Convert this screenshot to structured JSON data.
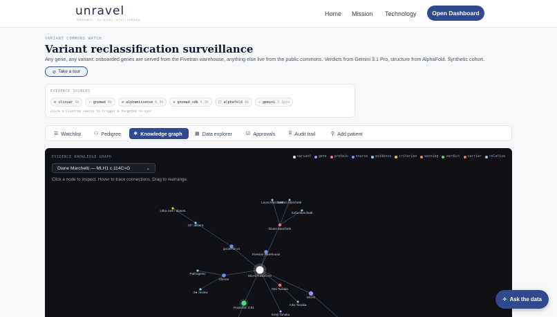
{
  "brand": {
    "name": "unravel",
    "tagline": "GENOMIC · CLINICAL INTELLIGENCE"
  },
  "nav": {
    "home": "Home",
    "mission": "Mission",
    "technology": "Technology",
    "cta": "Open Dashboard"
  },
  "header": {
    "eyebrow": "VARIANT COMMONS WATCH",
    "title": "Variant reclassification surveillance",
    "subtitle": "Any gene, any variant: onboarded genes are served from the Fivetran warehouse, anything else live from the public commons. Verdicts from Gemini 3.1 Pro, structure from AlphaFold. Synthetic cohort.",
    "tour": "Take a tour"
  },
  "sources": {
    "label": "EVIDENCE SOURCES",
    "hint": "click a Fivetran source to trigger a targeted re-sync",
    "chips": [
      {
        "icon": "database-icon",
        "glyph": "≡",
        "name": "clinvar",
        "count": "4k"
      },
      {
        "icon": "sparkle-icon",
        "glyph": "✧",
        "name": "gnomad",
        "count": "4k"
      },
      {
        "icon": "database-icon",
        "glyph": "≡",
        "name": "alphamissense",
        "count": "6.3k"
      },
      {
        "icon": "database-icon",
        "glyph": "≡",
        "name": "gnomad_sdk",
        "count": "6.3k"
      },
      {
        "icon": "cube-icon",
        "glyph": "⬡",
        "name": "alphafold",
        "count": "4b"
      },
      {
        "icon": "sparkle-icon",
        "glyph": "✧",
        "name": "gemini",
        "count": "3.1pro"
      }
    ]
  },
  "tabs": [
    {
      "key": "watchlist",
      "icon": "list-icon",
      "glyph": "☰",
      "label": "Watchlist"
    },
    {
      "key": "pedigree",
      "icon": "people-icon",
      "glyph": "⚇",
      "label": "Pedigree"
    },
    {
      "key": "knowledge",
      "icon": "graph-icon",
      "glyph": "⚛",
      "label": "Knowledge graph"
    },
    {
      "key": "explorer",
      "icon": "grid-icon",
      "glyph": "▦",
      "label": "Data explorer"
    },
    {
      "key": "approvals",
      "icon": "clipboard-icon",
      "glyph": "☑",
      "label": "Approvals"
    },
    {
      "key": "audit",
      "icon": "audit-icon",
      "glyph": "⌸",
      "label": "Audit trail"
    },
    {
      "key": "addpatient",
      "icon": "add-user-icon",
      "glyph": "⚲",
      "label": "Add patient"
    }
  ],
  "graph": {
    "label": "EVIDENCE KNOWLEDGE GRAPH",
    "selected_patient": "Diane Marchetti — MLH1 c.114C>G",
    "hint": "Click a node to inspect. Hover to trace connections. Drag to rearrange.",
    "legend": [
      {
        "label": "variant",
        "color": "#e5e7eb"
      },
      {
        "label": "gene",
        "color": "#a78bfa"
      },
      {
        "label": "protein",
        "color": "#f472b6"
      },
      {
        "label": "source",
        "color": "#60a5fa"
      },
      {
        "label": "evidence",
        "color": "#7dd3fc"
      },
      {
        "label": "criterion",
        "color": "#facc15"
      },
      {
        "label": "warning",
        "color": "#fb923c"
      },
      {
        "label": "verdict",
        "color": "#4ade80"
      },
      {
        "label": "carrier",
        "color": "#f87171"
      },
      {
        "label": "relative",
        "color": "#93c5fd"
      }
    ],
    "nodes": [
      {
        "label": "MLH1 c.114C>G",
        "kind": "variant",
        "color": "#ffffff",
        "r": 5.5
      },
      {
        "label": "Ultra-rare / absent",
        "kind": "criterion",
        "color": "#facc15",
        "r": 1.6
      },
      {
        "label": "AF: absent",
        "kind": "evidence",
        "color": "#7dd3fc",
        "r": 1.6
      },
      {
        "label": "gnomAD v4",
        "kind": "source",
        "color": "#6b8ee8",
        "r": 2.8
      },
      {
        "label": "Fivetran warehouse",
        "kind": "source",
        "color": "#6b8ee8",
        "r": 2.8
      },
      {
        "label": "Laura Marchetti",
        "kind": "relative",
        "color": "#93c5fd",
        "r": 1.5
      },
      {
        "label": "Matteo Marchetti",
        "kind": "relative",
        "color": "#93c5fd",
        "r": 1.5
      },
      {
        "label": "Sofia Marchetti",
        "kind": "relative",
        "color": "#93c5fd",
        "r": 1.5
      },
      {
        "label": "Diane Marchetti",
        "kind": "carrier",
        "color": "#f87171",
        "r": 2.2
      },
      {
        "label": "Pathogenic",
        "kind": "evidence",
        "color": "#7dd3fc",
        "r": 1.6
      },
      {
        "label": "ClinVar",
        "kind": "source",
        "color": "#6b8ee8",
        "r": 2.8
      },
      {
        "label": "3★ review",
        "kind": "evidence",
        "color": "#7dd3fc",
        "r": 1.6
      },
      {
        "label": "Mei Tanaka",
        "kind": "carrier",
        "color": "#f87171",
        "r": 2.2
      },
      {
        "label": "MLH1",
        "kind": "gene",
        "color": "#a78bfa",
        "r": 3.2
      },
      {
        "label": "Aiko Tanaka",
        "kind": "relative",
        "color": "#93c5fd",
        "r": 1.5
      },
      {
        "label": "Posterior: 0.81",
        "kind": "verdict",
        "color": "#4ade80",
        "r": 3.6
      },
      {
        "label": "Kenji Tanaka",
        "kind": "relative",
        "color": "#93c5fd",
        "r": 1.5
      }
    ],
    "edges": [
      [
        0,
        3
      ],
      [
        0,
        4
      ],
      [
        0,
        8
      ],
      [
        0,
        10
      ],
      [
        0,
        12
      ],
      [
        0,
        13
      ],
      [
        0,
        15
      ],
      [
        0,
        16
      ],
      [
        3,
        2
      ],
      [
        2,
        1
      ],
      [
        8,
        5
      ],
      [
        8,
        6
      ],
      [
        8,
        7
      ],
      [
        10,
        9
      ],
      [
        10,
        11
      ],
      [
        12,
        14
      ]
    ]
  },
  "assistant": {
    "label": "Ask the data"
  }
}
